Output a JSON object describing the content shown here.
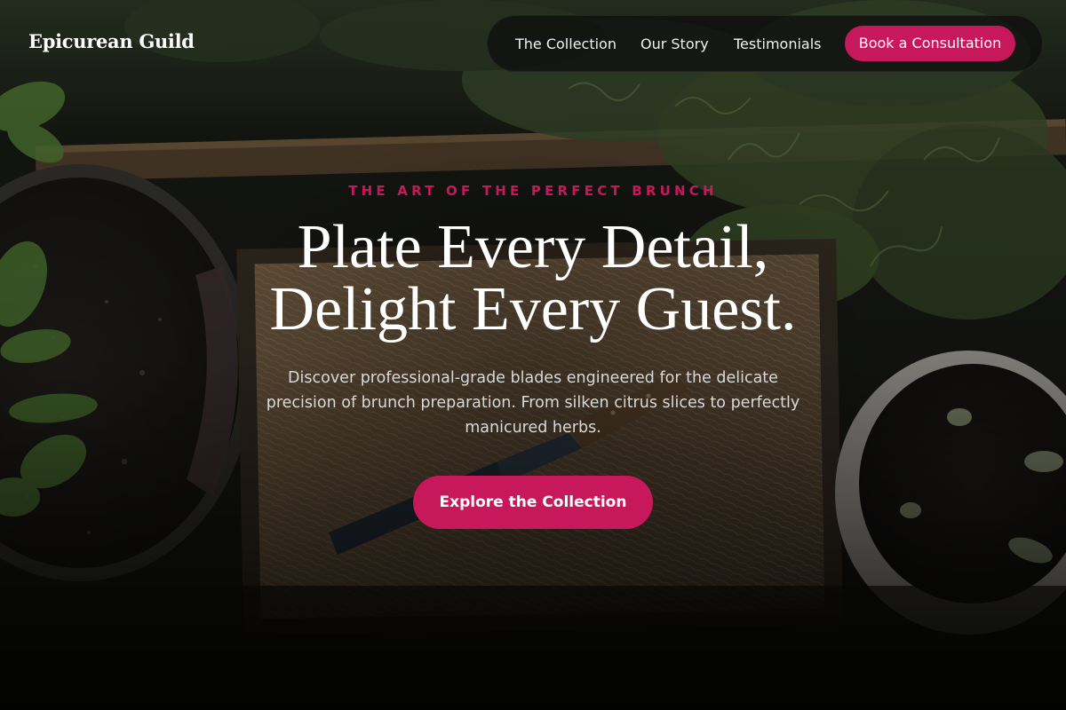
{
  "brand": {
    "logo_text": "Epicurean Guild",
    "accent_color": "#c8185c"
  },
  "nav": {
    "links": [
      {
        "label": "The Collection"
      },
      {
        "label": "Our Story"
      },
      {
        "label": "Testimonials"
      }
    ],
    "cta_label": "Book a Consultation"
  },
  "hero": {
    "eyebrow": "THE ART OF THE PERFECT BRUNCH",
    "headline_line1": "Plate Every Detail,",
    "headline_line2": "Delight Every Guest.",
    "description_lines": [
      "Discover professional-grade blades engineered for the delicate",
      "precision of brunch preparation. From silken citrus slices to perfectly",
      "manicured herbs."
    ],
    "cta_label": "Explore the Collection",
    "background_image": "overhead-garden-knife-on-straw-tray"
  }
}
